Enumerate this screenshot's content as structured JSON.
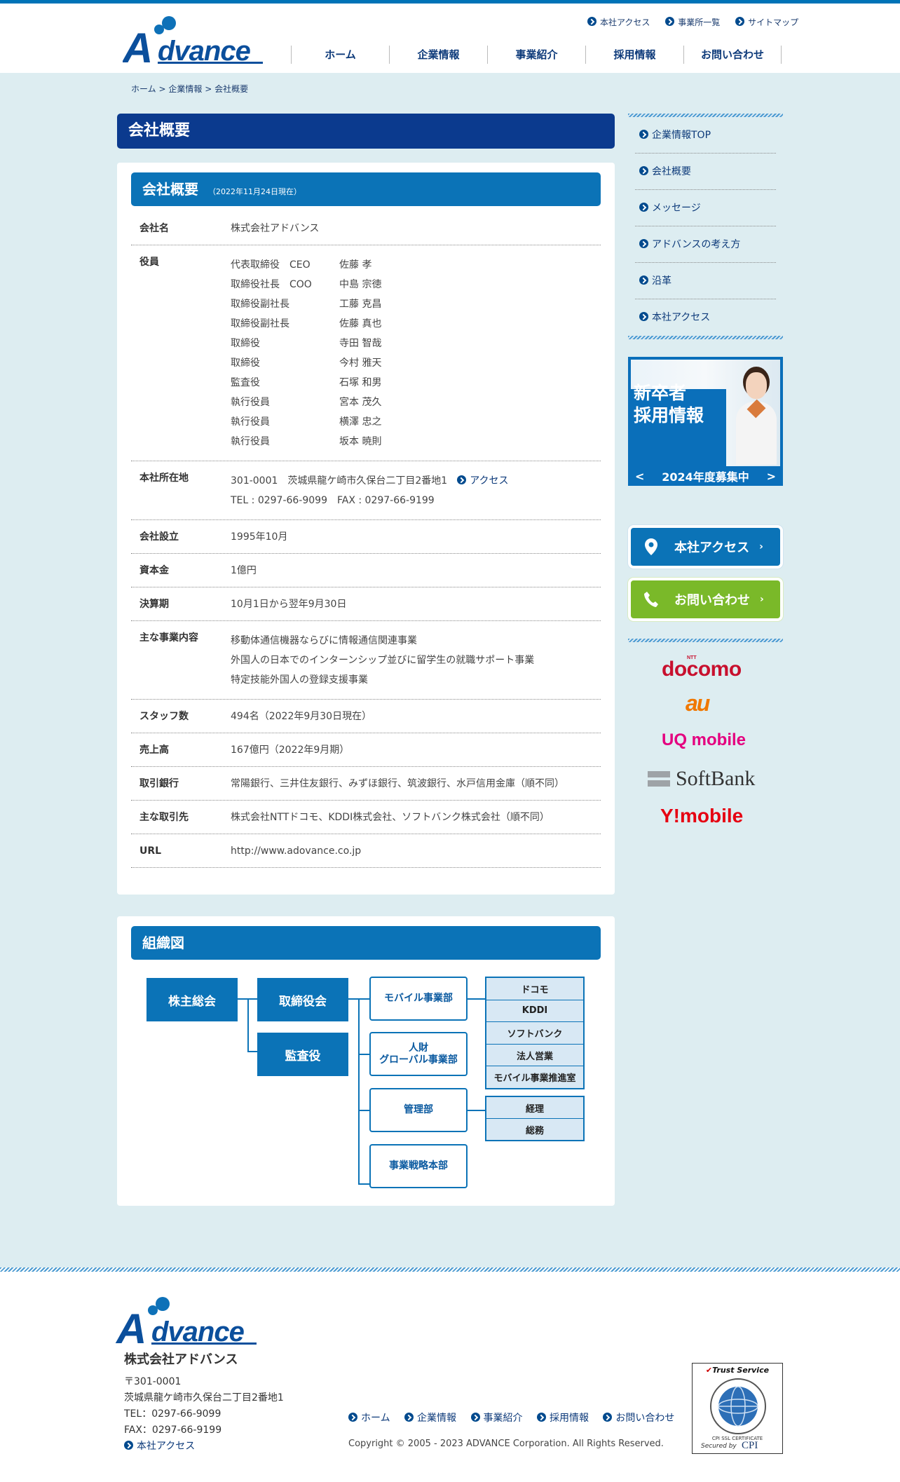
{
  "brand": {
    "logo_text": "Advance",
    "colors": {
      "primary": "#0b73b7",
      "dark": "#0b3a8e",
      "background": "#ddedf1",
      "green": "#7ab929"
    }
  },
  "util_nav": [
    "本社アクセス",
    "事業所一覧",
    "サイトマップ"
  ],
  "global_nav": [
    "ホーム",
    "企業情報",
    "事業紹介",
    "採用情報",
    "お問い合わせ"
  ],
  "breadcrumb": [
    "ホーム",
    "企業情報",
    "会社概要"
  ],
  "page_title": "会社概要",
  "overview": {
    "heading": "会社概要",
    "as_of": "（2022年11月24日現在）",
    "company_label": "会社名",
    "company": "株式会社アドバンス",
    "officers_label": "役員",
    "officers": [
      {
        "pos": "代表取締役　CEO",
        "name": "佐藤 孝"
      },
      {
        "pos": "取締役社長　COO",
        "name": "中島 宗徳"
      },
      {
        "pos": "取締役副社長",
        "name": "工藤 克昌"
      },
      {
        "pos": "取締役副社長",
        "name": "佐藤 真也"
      },
      {
        "pos": "取締役",
        "name": "寺田 智哉"
      },
      {
        "pos": "取締役",
        "name": "今村 雅天"
      },
      {
        "pos": "監査役",
        "name": "石塚 和男"
      },
      {
        "pos": "執行役員",
        "name": "宮本 茂久"
      },
      {
        "pos": "執行役員",
        "name": "横澤 忠之"
      },
      {
        "pos": "執行役員",
        "name": "坂本 暁則"
      }
    ],
    "hq_label": "本社所在地",
    "hq_address": "301-0001　茨城県龍ケ崎市久保台二丁目2番地1",
    "hq_access_link": "アクセス",
    "hq_phone": "TEL : 0297-66-9099　FAX : 0297-66-9199",
    "founded_label": "会社設立",
    "founded": "1995年10月",
    "capital_label": "資本金",
    "capital": "1億円",
    "fiscal_label": "決算期",
    "fiscal": "10月1日から翌年9月30日",
    "business_label": "主な事業内容",
    "business": [
      "移動体通信機器ならびに情報通信関連事業",
      "外国人の日本でのインターンシップ並びに留学生の就職サポート事業",
      "特定技能外国人の登録支援事業"
    ],
    "staff_label": "スタッフ数",
    "staff": "494名（2022年9月30日現在）",
    "sales_label": "売上高",
    "sales": "167億円（2022年9月期）",
    "banks_label": "取引銀行",
    "banks": "常陽銀行、三井住友銀行、みずほ銀行、筑波銀行、水戸信用金庫（順不同）",
    "clients_label": "主な取引先",
    "clients": "株式会社NTTドコモ、KDDI株式会社、ソフトバンク株式会社（順不同）",
    "url_label": "URL",
    "url": "http://www.adovance.co.jp"
  },
  "org": {
    "heading": "組織図",
    "shareholders": "株主総会",
    "board": "取締役会",
    "auditor": "監査役",
    "mobile_div": "モバイル事業部",
    "hr_global_div": "人財\nグローバル事業部",
    "admin_div": "管理部",
    "strategy_div": "事業戦略本部",
    "mobile_units": [
      "ドコモ",
      "KDDI",
      "ソフトバンク",
      "法人営業",
      "モバイル事業推進室"
    ],
    "admin_units": [
      "経理",
      "総務"
    ]
  },
  "sidebar": {
    "menu": [
      "企業情報TOP",
      "会社概要",
      "メッセージ",
      "アドバンスの考え方",
      "沿革",
      "本社アクセス"
    ],
    "banner_line1": "新卒者",
    "banner_line2": "採用情報",
    "banner_recruit": "2024年度募集中",
    "access_button": "本社アクセス",
    "contact_button": "お問い合わせ",
    "carriers": [
      "docomo",
      "au",
      "UQ mobile",
      "SoftBank",
      "Y!mobile"
    ],
    "docomo_small": "NTT"
  },
  "footer": {
    "company": "株式会社アドバンス",
    "postal": "〒301-0001",
    "address": "茨城県龍ケ崎市久保台二丁目2番地1",
    "tel": "TEL：0297-66-9099",
    "fax": "FAX：0297-66-9199",
    "access_link": "本社アクセス",
    "nav": [
      "ホーム",
      "企業情報",
      "事業紹介",
      "採用情報",
      "お問い合わせ"
    ],
    "copyright": "Copyright © 2005 - 2023 ADVANCE Corporation. All Rights Reserved.",
    "trust_title": "Trust Service",
    "trust_ring": "CPI SSL CERTIFICATE",
    "trust_secured": "Secured by",
    "trust_brand": "CPI"
  }
}
